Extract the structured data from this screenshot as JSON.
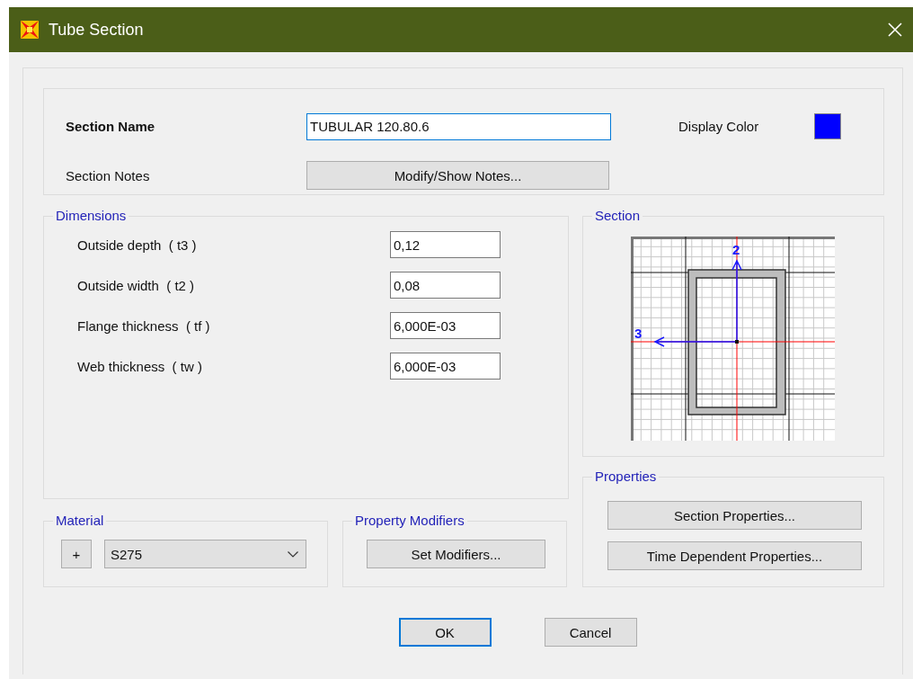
{
  "window": {
    "title": "Tube Section"
  },
  "section_name": {
    "label": "Section Name",
    "value": "TUBULAR 120.80.6",
    "focused": true
  },
  "display_color": {
    "label": "Display Color",
    "color": "#0000ff"
  },
  "section_notes": {
    "label": "Section Notes",
    "button": "Modify/Show Notes..."
  },
  "dimensions": {
    "title": "Dimensions",
    "rows": [
      {
        "label": "Outside depth  ( t3 )",
        "value": "0,12"
      },
      {
        "label": "Outside width  ( t2 )",
        "value": "0,08"
      },
      {
        "label": "Flange thickness  ( tf )",
        "value": "6,000E-03"
      },
      {
        "label": "Web thickness  ( tw )",
        "value": "6,000E-03"
      }
    ]
  },
  "section": {
    "title": "Section",
    "axis_labels": [
      "2",
      "3"
    ]
  },
  "properties": {
    "title": "Properties",
    "buttons": [
      "Section Properties...",
      "Time Dependent Properties..."
    ]
  },
  "material": {
    "title": "Material",
    "add_button": "+",
    "value": "S275"
  },
  "property_modifiers": {
    "title": "Property Modifiers",
    "button": "Set Modifiers..."
  },
  "buttons": [
    {
      "label": "OK",
      "default": true
    },
    {
      "label": "Cancel",
      "default": false
    }
  ]
}
